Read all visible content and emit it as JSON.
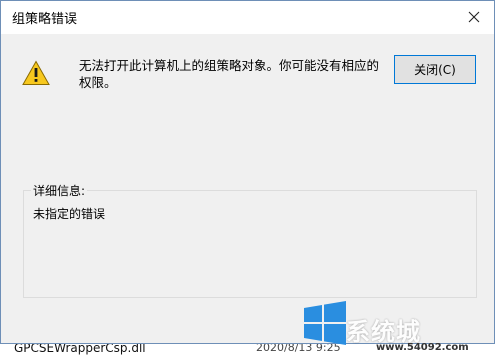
{
  "dialog": {
    "title": "组策略错误",
    "message": "无法打开此计算机上的组策略对象。你可能没有相应的权限。",
    "close_button_label": "关闭(C)",
    "details_label": "详细信息:",
    "details_text": "未指定的错误"
  },
  "background": {
    "bottom_file_name": "GPCSEWrapperCsp.dll",
    "bottom_file_date": "2020/8/13 9:25"
  },
  "watermark": {
    "text": "系统城",
    "url": "www.54092.com"
  },
  "colors": {
    "accent": "#0078d7",
    "dialog_bg": "#f0f0f0",
    "border": "#6e8fb7",
    "warning": "#f7c81e"
  },
  "icons": {
    "close": "close-icon",
    "warning": "warning-icon",
    "windows_logo": "windows-logo-icon"
  }
}
